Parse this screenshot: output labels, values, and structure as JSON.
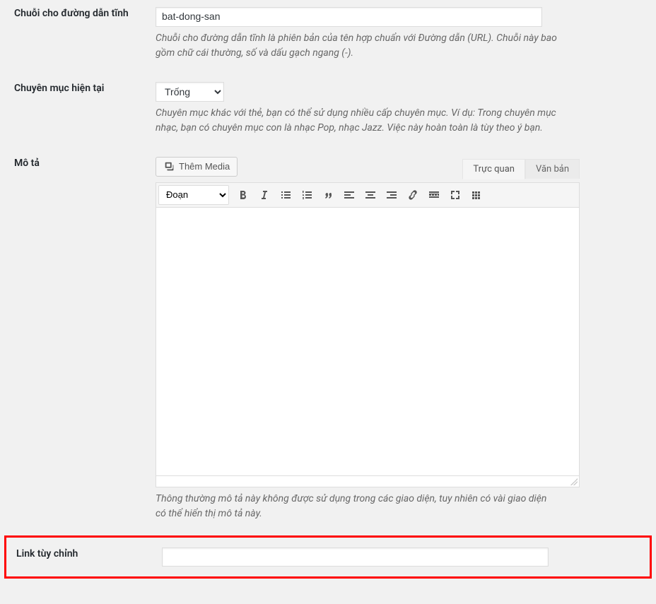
{
  "fields": {
    "slug": {
      "label": "Chuỗi cho đường dẫn tĩnh",
      "value": "bat-dong-san",
      "description": "Chuỗi cho đường dẫn tĩnh là phiên bản của tên hợp chuẩn với Đường dẫn (URL). Chuỗi này bao gồm chữ cái thường, số và dấu gạch ngang (-)."
    },
    "parent": {
      "label": "Chuyên mục hiện tại",
      "selected": "Trống",
      "description": "Chuyên mục khác với thẻ, bạn có thể sử dụng nhiều cấp chuyên mục. Ví dụ: Trong chuyên mục nhạc, bạn có chuyên mục con là nhạc Pop, nhạc Jazz. Việc này hoàn toàn là tùy theo ý bạn."
    },
    "description": {
      "label": "Mô tả",
      "media_button": "Thêm Media",
      "tabs": {
        "visual": "Trực quan",
        "text": "Văn bản"
      },
      "format": "Đoạn",
      "desc_text": "Thông thường mô tả này không được sử dụng trong các giao diện, tuy nhiên có vài giao diện có thể hiển thị mô tả này."
    },
    "custom_link": {
      "label": "Link tùy chỉnh",
      "value": ""
    }
  }
}
